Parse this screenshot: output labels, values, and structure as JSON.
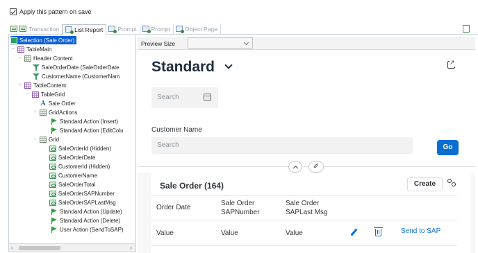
{
  "options": {
    "apply_pattern_label": "Apply this pattern on save",
    "apply_pattern_checked": true
  },
  "tabs": [
    {
      "label": "Transaction",
      "active": false
    },
    {
      "label": "List Report",
      "active": true
    },
    {
      "label": "Prompt",
      "active": false
    },
    {
      "label": "Prompt",
      "active": false
    },
    {
      "label": "Object Page",
      "active": false
    }
  ],
  "tree": {
    "items": [
      {
        "label": "Selection (Sale Order)",
        "icon": "root-icon",
        "selected": true
      },
      {
        "label": "TableMain",
        "icon": "grid-icon"
      },
      {
        "label": "Header Content",
        "icon": "grid-gray-icon"
      },
      {
        "label": "SaleOrderDate (SaleOrderDate",
        "icon": "filter-icon"
      },
      {
        "label": "CustomerName (CustomerNam",
        "icon": "filter-icon"
      },
      {
        "label": "TableContent",
        "icon": "grid-icon"
      },
      {
        "label": "TableGrid",
        "icon": "grid-icon"
      },
      {
        "label": "Sale Order",
        "icon": "text-a-icon"
      },
      {
        "label": "GridActions",
        "icon": "grid-gray-icon"
      },
      {
        "label": "Standard Action (Insert)",
        "icon": "flag-icon"
      },
      {
        "label": "Standard Action (EditColu",
        "icon": "flag-icon"
      },
      {
        "label": "Grid",
        "icon": "grid-gray-icon"
      },
      {
        "label": "SaleOrderId (Hidden)",
        "icon": "attribute-icon"
      },
      {
        "label": "SaleOrderDate",
        "icon": "attribute-icon"
      },
      {
        "label": "CustomerId (Hidden)",
        "icon": "attribute-icon"
      },
      {
        "label": "CustomerName",
        "icon": "attribute-icon"
      },
      {
        "label": "SaleOrderTotal",
        "icon": "attribute-icon"
      },
      {
        "label": "SaleOrderSAPNumber",
        "icon": "attribute-icon"
      },
      {
        "label": "SaleOrderSAPLastMsg",
        "icon": "attribute-icon"
      },
      {
        "label": "Standard Action (Update)",
        "icon": "flag-icon"
      },
      {
        "label": "Standard Action (Delete)",
        "icon": "flag-icon"
      },
      {
        "label": "User Action (SendToSAP)",
        "icon": "flag-icon"
      }
    ],
    "scroll_left": "‹",
    "scroll_right": "›"
  },
  "preview": {
    "label": "Preview Size",
    "selected_value": ""
  },
  "page": {
    "title": "Standard"
  },
  "filters": {
    "search_placeholder": "Search",
    "customer_label": "Customer Name",
    "customer_placeholder": "Search",
    "go_label": "Go"
  },
  "pin_glyph": "✐",
  "table": {
    "title": "Sale Order (164)",
    "create_label": "Create",
    "columns": [
      [
        "Order Date"
      ],
      [
        "Sale Order",
        "SAPNumber"
      ],
      [
        "Sale Order",
        "SAPLast Msg"
      ]
    ],
    "row": {
      "cells": [
        "Value",
        "Value",
        "Value"
      ],
      "action_label": "Send to SAP"
    }
  },
  "colors": {
    "accent": "#0a6ed1",
    "tree_selection": "#0a5fd6",
    "title_text": "#1d2d3e"
  }
}
